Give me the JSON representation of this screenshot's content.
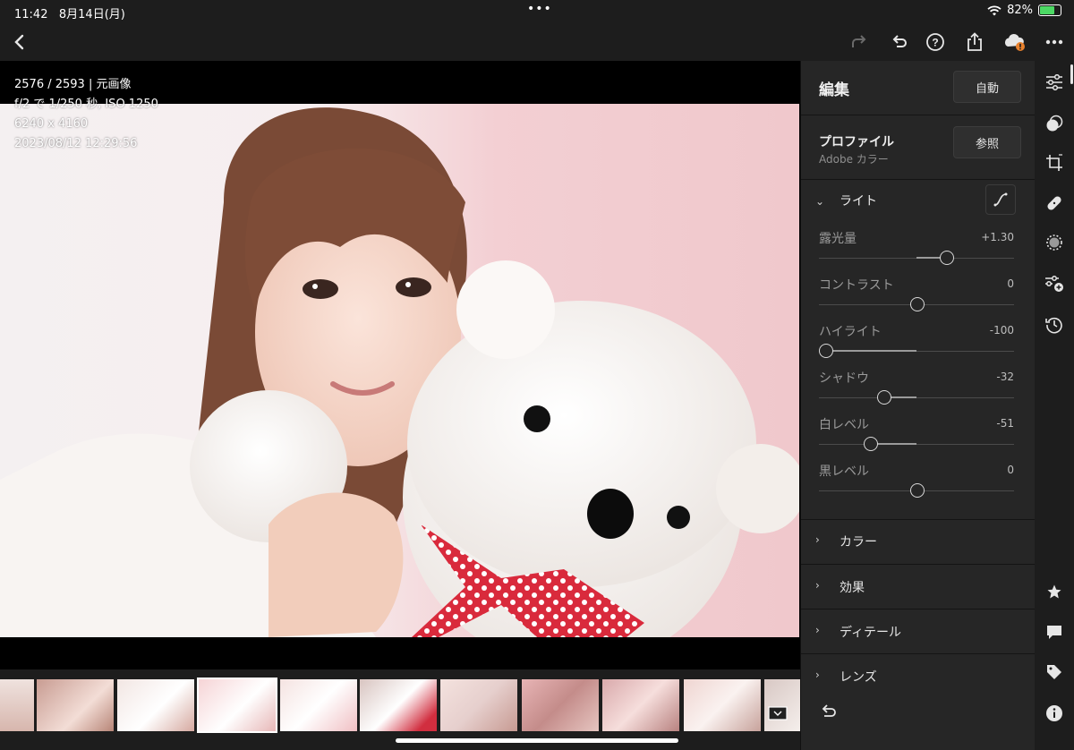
{
  "statusbar": {
    "time": "11:42",
    "date": "8月14日(月)",
    "battery": "82%",
    "battery_level": 0.82
  },
  "photo_info": {
    "index": "2576 / 2593 | 元画像",
    "exposure": "f/2 で 1/250 秒, ISO 1250",
    "dimensions": "6240 x 4160",
    "datetime": "2023/08/12 12:29:56"
  },
  "toolbar": {
    "icons": [
      "back-icon",
      "redo-icon",
      "undo-icon",
      "help-icon",
      "share-icon",
      "cloud-sync-icon",
      "more-icon"
    ]
  },
  "panel": {
    "title": "編集",
    "auto_label": "自動",
    "profile": {
      "label": "プロファイル",
      "value": "Adobe カラー",
      "browse_label": "参照"
    },
    "light": {
      "label": "ライト",
      "sliders": [
        {
          "label": "露光量",
          "value": "+1.30",
          "pos": 0.66
        },
        {
          "label": "コントラスト",
          "value": "0",
          "pos": 0.5
        },
        {
          "label": "ハイライト",
          "value": "-100",
          "pos": 0.0
        },
        {
          "label": "シャドウ",
          "value": "-32",
          "pos": 0.32
        },
        {
          "label": "白レベル",
          "value": "-51",
          "pos": 0.245
        },
        {
          "label": "黒レベル",
          "value": "0",
          "pos": 0.5
        }
      ]
    },
    "sections": [
      "カラー",
      "効果",
      "ディテール",
      "レンズ"
    ]
  },
  "rail": {
    "icons": [
      "edit-sliders-icon",
      "presets-icon",
      "crop-icon",
      "healing-icon",
      "masking-icon",
      "versions-icon",
      "history-icon"
    ],
    "bottom_icons": [
      "star-icon",
      "comment-icon",
      "tag-icon",
      "info-icon"
    ]
  },
  "colors": {
    "accent": "#e0e0e0",
    "panel_bg": "#262626",
    "app_bg": "#1d1d1d",
    "warning": "#e8812d"
  }
}
